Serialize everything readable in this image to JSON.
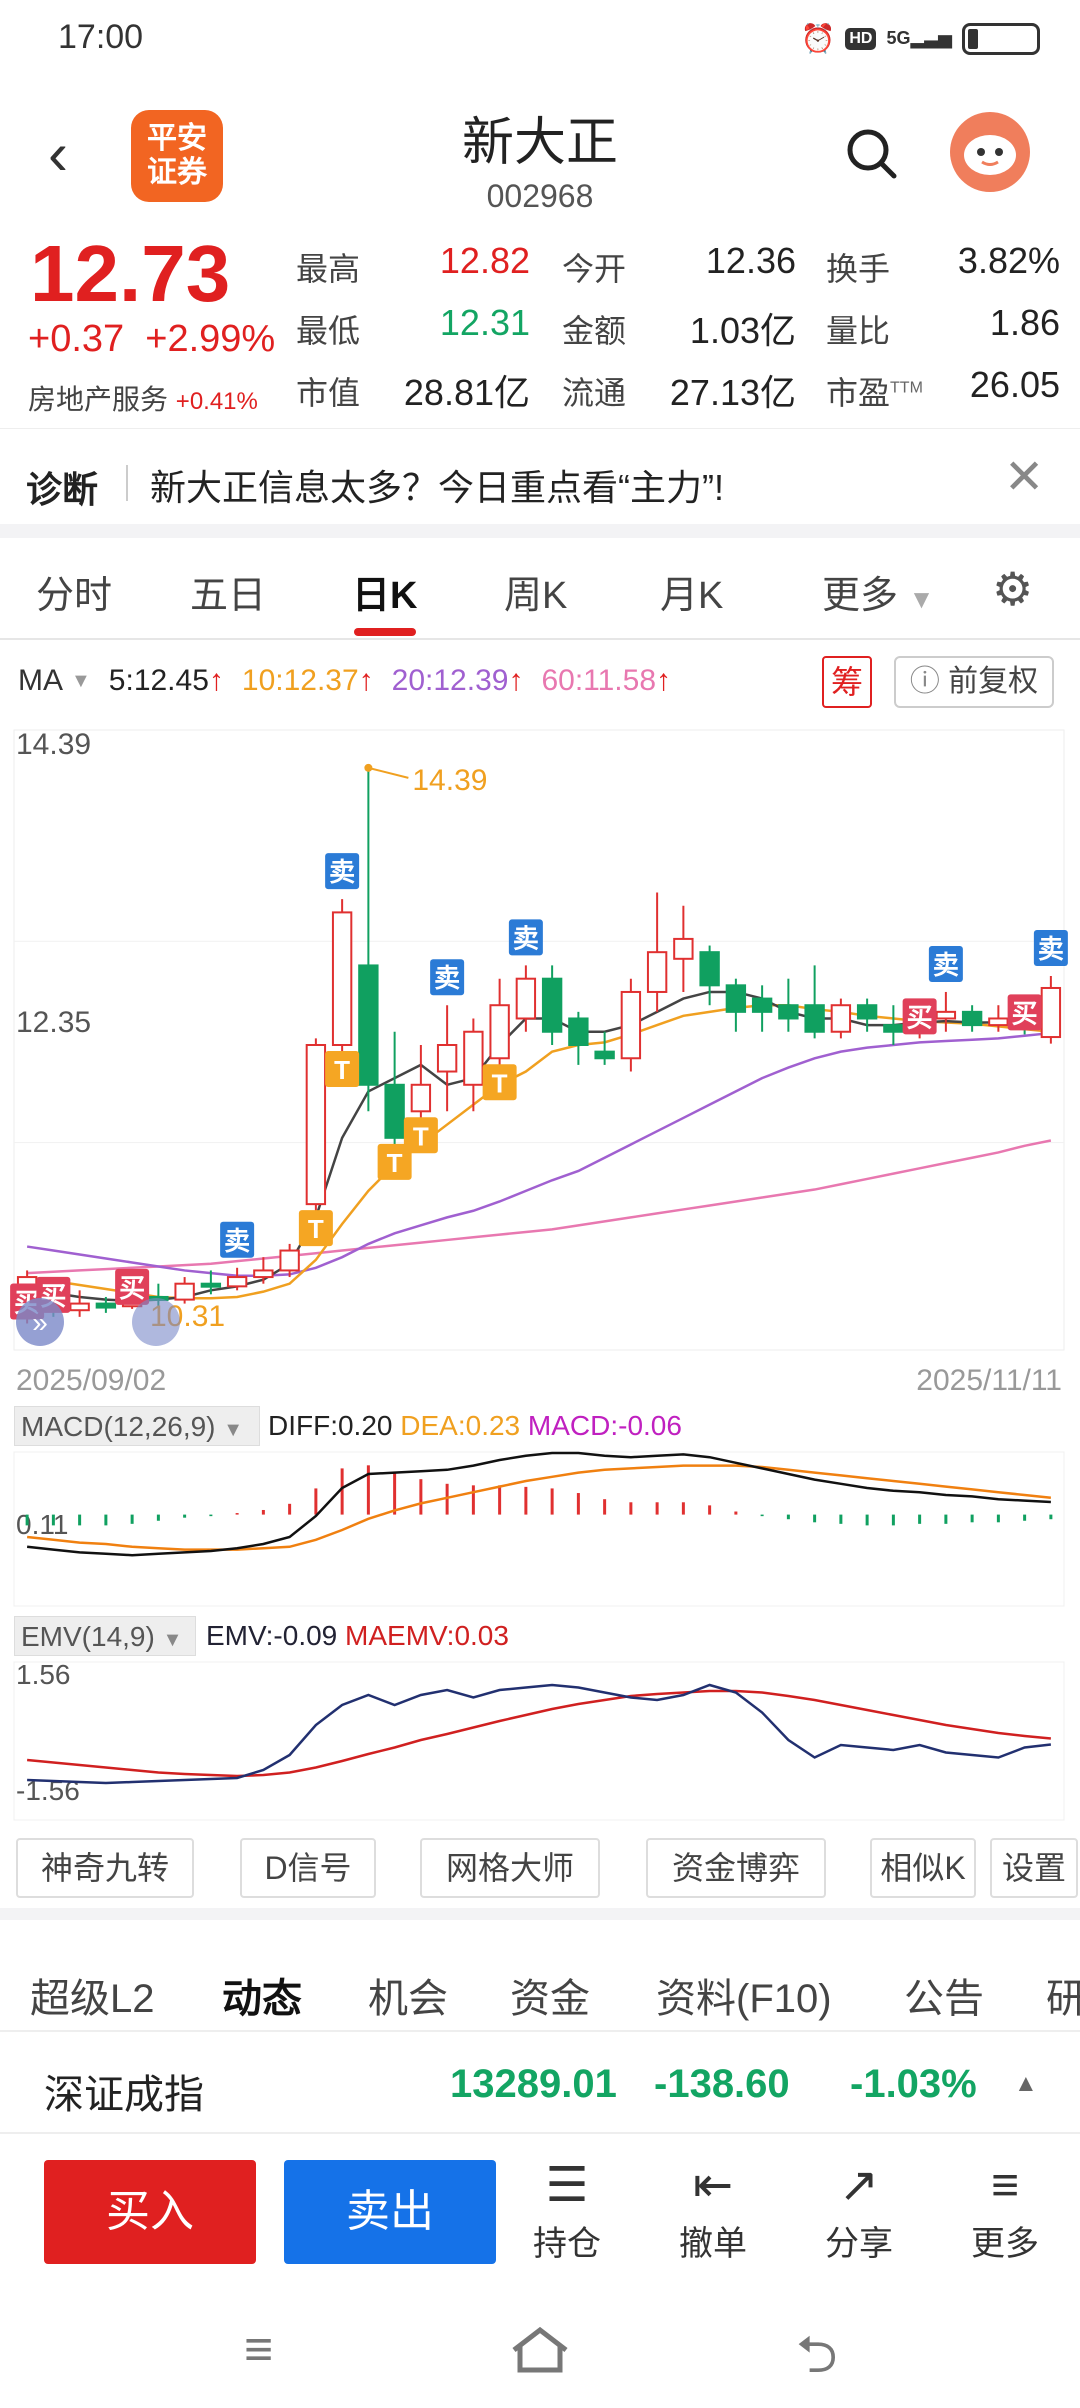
{
  "status": {
    "time": "17:00",
    "net": "5G",
    "hd": "HD"
  },
  "header": {
    "broker_logo": "平安\n证券",
    "name": "新大正",
    "code": "002968"
  },
  "quote": {
    "price": "12.73",
    "change": "+0.37",
    "change_pct": "+2.99%",
    "sector": "房地产服务",
    "sector_pct": "+0.41%",
    "cells": [
      {
        "label": "最高",
        "value": "12.82",
        "color": "red"
      },
      {
        "label": "今开",
        "value": "12.36",
        "color": "normal"
      },
      {
        "label": "换手",
        "value": "3.82%",
        "color": "normal"
      },
      {
        "label": "最低",
        "value": "12.31",
        "color": "green"
      },
      {
        "label": "金额",
        "value": "1.03亿",
        "color": "normal"
      },
      {
        "label": "量比",
        "value": "1.86",
        "color": "normal"
      },
      {
        "label": "市值",
        "value": "28.81亿",
        "color": "normal"
      },
      {
        "label": "流通",
        "value": "27.13亿",
        "color": "normal"
      },
      {
        "label": "市盈",
        "value": "26.05",
        "color": "normal",
        "sup": "TTM"
      }
    ]
  },
  "diagnosis": {
    "tag": "诊断",
    "message": "新大正信息太多？今日重点看“主力”!"
  },
  "chart_tabs": [
    {
      "label": "分时"
    },
    {
      "label": "五日"
    },
    {
      "label": "日K",
      "active": true
    },
    {
      "label": "周K"
    },
    {
      "label": "月K"
    },
    {
      "label": "更多"
    }
  ],
  "ma": {
    "label": "MA",
    "items": [
      {
        "text": "5:12.45",
        "color": "#222"
      },
      {
        "text": "10:12.37",
        "color": "#f0a020"
      },
      {
        "text": "20:12.39",
        "color": "#a060d0"
      },
      {
        "text": "60:11.58",
        "color": "#e878b0"
      }
    ],
    "chou": "筹",
    "fuquan": "前复权"
  },
  "chart_data": {
    "type": "candlestick",
    "y_max_label": "14.39",
    "y_mid_label": "12.35",
    "low_label": "10.31",
    "high_annotation": "14.39",
    "ylim": [
      10.0,
      14.5
    ],
    "start_date": "2025/09/02",
    "end_date": "2025/11/11",
    "candles": [
      [
        10.35,
        10.55,
        10.2,
        10.6
      ],
      [
        10.5,
        10.3,
        10.25,
        10.55
      ],
      [
        10.3,
        10.35,
        10.25,
        10.45
      ],
      [
        10.35,
        10.32,
        10.28,
        10.4
      ],
      [
        10.33,
        10.4,
        10.31,
        10.45
      ],
      [
        10.4,
        10.38,
        10.32,
        10.5
      ],
      [
        10.38,
        10.5,
        10.35,
        10.55
      ],
      [
        10.5,
        10.48,
        10.42,
        10.6
      ],
      [
        10.48,
        10.55,
        10.45,
        10.62
      ],
      [
        10.55,
        10.6,
        10.5,
        10.7
      ],
      [
        10.6,
        10.75,
        10.55,
        10.8
      ],
      [
        11.1,
        12.3,
        11.0,
        12.35
      ],
      [
        12.3,
        13.3,
        12.2,
        13.4
      ],
      [
        12.9,
        12.0,
        11.8,
        14.39
      ],
      [
        12.0,
        11.6,
        11.5,
        12.4
      ],
      [
        11.8,
        12.0,
        11.7,
        12.3
      ],
      [
        12.1,
        12.3,
        11.8,
        12.6
      ],
      [
        12.0,
        12.4,
        11.8,
        12.5
      ],
      [
        12.2,
        12.6,
        12.1,
        12.8
      ],
      [
        12.5,
        12.8,
        12.4,
        12.9
      ],
      [
        12.8,
        12.4,
        12.3,
        12.9
      ],
      [
        12.5,
        12.3,
        12.15,
        12.55
      ],
      [
        12.25,
        12.2,
        12.15,
        12.4
      ],
      [
        12.2,
        12.7,
        12.1,
        12.8
      ],
      [
        12.7,
        13.0,
        12.55,
        13.45
      ],
      [
        12.95,
        13.1,
        12.7,
        13.35
      ],
      [
        13.0,
        12.75,
        12.6,
        13.05
      ],
      [
        12.75,
        12.55,
        12.4,
        12.8
      ],
      [
        12.65,
        12.55,
        12.4,
        12.75
      ],
      [
        12.6,
        12.5,
        12.4,
        12.8
      ],
      [
        12.6,
        12.4,
        12.35,
        12.9
      ],
      [
        12.4,
        12.6,
        12.35,
        12.65
      ],
      [
        12.6,
        12.5,
        12.4,
        12.65
      ],
      [
        12.45,
        12.4,
        12.3,
        12.6
      ],
      [
        12.4,
        12.5,
        12.35,
        12.6
      ],
      [
        12.5,
        12.55,
        12.4,
        12.7
      ],
      [
        12.55,
        12.45,
        12.4,
        12.6
      ],
      [
        12.45,
        12.5,
        12.4,
        12.6
      ],
      [
        12.5,
        12.45,
        12.38,
        12.6
      ],
      [
        12.36,
        12.73,
        12.31,
        12.82
      ]
    ],
    "ma5": [
      10.45,
      10.43,
      10.4,
      10.38,
      10.37,
      10.38,
      10.4,
      10.45,
      10.48,
      10.53,
      10.65,
      11.0,
      11.6,
      11.95,
      12.05,
      12.15,
      12.0,
      12.05,
      12.3,
      12.5,
      12.5,
      12.4,
      12.4,
      12.45,
      12.55,
      12.65,
      12.7,
      12.7,
      12.65,
      12.55,
      12.5,
      12.5,
      12.45,
      12.45,
      12.47,
      12.48,
      12.47,
      12.47,
      12.48,
      12.45
    ],
    "ma10": [
      10.55,
      10.52,
      10.49,
      10.46,
      10.43,
      10.4,
      10.39,
      10.39,
      10.4,
      10.44,
      10.5,
      10.68,
      10.95,
      11.2,
      11.4,
      11.55,
      11.7,
      11.85,
      12.0,
      12.1,
      12.25,
      12.3,
      12.32,
      12.38,
      12.45,
      12.52,
      12.55,
      12.58,
      12.6,
      12.6,
      12.57,
      12.55,
      12.52,
      12.5,
      12.48,
      12.47,
      12.46,
      12.44,
      12.42,
      12.4
    ],
    "ma20": [
      10.78,
      10.75,
      10.72,
      10.69,
      10.66,
      10.63,
      10.6,
      10.58,
      10.56,
      10.56,
      10.57,
      10.62,
      10.7,
      10.8,
      10.88,
      10.94,
      11.0,
      11.05,
      11.12,
      11.2,
      11.28,
      11.35,
      11.45,
      11.55,
      11.65,
      11.75,
      11.85,
      11.95,
      12.05,
      12.13,
      12.2,
      12.25,
      12.28,
      12.3,
      12.32,
      12.33,
      12.34,
      12.35,
      12.37,
      12.39
    ],
    "ma60": [
      10.58,
      10.59,
      10.6,
      10.61,
      10.62,
      10.63,
      10.64,
      10.65,
      10.67,
      10.69,
      10.71,
      10.73,
      10.75,
      10.77,
      10.79,
      10.81,
      10.83,
      10.85,
      10.87,
      10.89,
      10.91,
      10.94,
      10.97,
      11.0,
      11.03,
      11.06,
      11.09,
      11.12,
      11.15,
      11.18,
      11.21,
      11.25,
      11.29,
      11.33,
      11.37,
      11.41,
      11.45,
      11.49,
      11.54,
      11.58
    ],
    "markers": [
      {
        "i": 0,
        "text": "买",
        "type": "buy"
      },
      {
        "i": 1,
        "text": "买",
        "type": "buy"
      },
      {
        "i": 4,
        "text": "买",
        "type": "buy"
      },
      {
        "i": 8,
        "text": "卖",
        "type": "sell"
      },
      {
        "i": 11,
        "text": "T",
        "type": "t"
      },
      {
        "i": 14,
        "text": "T",
        "type": "t"
      },
      {
        "i": 15,
        "text": "T",
        "type": "t"
      },
      {
        "i": 12,
        "text": "T",
        "type": "t"
      },
      {
        "i": 12,
        "text": "卖",
        "type": "sell",
        "high": true
      },
      {
        "i": 16,
        "text": "卖",
        "type": "sell",
        "high": true
      },
      {
        "i": 18,
        "text": "T",
        "type": "t"
      },
      {
        "i": 19,
        "text": "卖",
        "type": "sell",
        "high": true
      },
      {
        "i": 34,
        "text": "买",
        "type": "buy"
      },
      {
        "i": 35,
        "text": "卖",
        "type": "sell"
      },
      {
        "i": 38,
        "text": "买",
        "type": "buy"
      },
      {
        "i": 39,
        "text": "卖",
        "type": "sell",
        "high": true
      }
    ],
    "macd": {
      "label": "MACD(12,26,9)",
      "diff": "DIFF:0.20",
      "dea": "DEA:0.23",
      "macdv": "MACD:-0.06",
      "axis": "0.11",
      "diff_series": [
        -0.12,
        -0.14,
        -0.16,
        -0.17,
        -0.18,
        -0.17,
        -0.16,
        -0.15,
        -0.13,
        -0.1,
        -0.05,
        0.1,
        0.3,
        0.4,
        0.41,
        0.42,
        0.43,
        0.46,
        0.5,
        0.53,
        0.55,
        0.55,
        0.53,
        0.52,
        0.53,
        0.54,
        0.52,
        0.48,
        0.44,
        0.4,
        0.36,
        0.33,
        0.3,
        0.28,
        0.27,
        0.25,
        0.24,
        0.22,
        0.21,
        0.2
      ],
      "dea_series": [
        -0.05,
        -0.07,
        -0.09,
        -0.1,
        -0.12,
        -0.13,
        -0.14,
        -0.14,
        -0.14,
        -0.13,
        -0.12,
        -0.07,
        0.0,
        0.08,
        0.14,
        0.19,
        0.23,
        0.27,
        0.31,
        0.35,
        0.38,
        0.41,
        0.43,
        0.44,
        0.45,
        0.46,
        0.46,
        0.46,
        0.45,
        0.43,
        0.41,
        0.39,
        0.37,
        0.35,
        0.33,
        0.31,
        0.29,
        0.27,
        0.25,
        0.23
      ],
      "hist": [
        -0.14,
        -0.14,
        -0.14,
        -0.14,
        -0.12,
        -0.08,
        -0.04,
        -0.02,
        0.02,
        0.06,
        0.14,
        0.34,
        0.6,
        0.64,
        0.54,
        0.46,
        0.4,
        0.38,
        0.38,
        0.36,
        0.34,
        0.28,
        0.2,
        0.16,
        0.16,
        0.16,
        0.12,
        0.04,
        -0.02,
        -0.06,
        -0.1,
        -0.12,
        -0.14,
        -0.14,
        -0.12,
        -0.12,
        -0.1,
        -0.1,
        -0.08,
        -0.06
      ]
    },
    "emv": {
      "label": "EMV(14,9)",
      "emv_text": "EMV:-0.09",
      "maemv_text": "MAEMV:0.03",
      "top": "1.56",
      "bottom": "-1.56",
      "emv_series": [
        -0.8,
        -0.82,
        -0.84,
        -0.86,
        -0.84,
        -0.82,
        -0.8,
        -0.78,
        -0.76,
        -0.6,
        -0.3,
        0.3,
        0.7,
        0.9,
        0.7,
        0.9,
        1.0,
        0.85,
        1.0,
        1.05,
        1.1,
        1.05,
        0.95,
        0.85,
        0.8,
        0.9,
        1.1,
        0.95,
        0.55,
        0.0,
        -0.35,
        -0.1,
        -0.15,
        -0.2,
        -0.1,
        -0.25,
        -0.3,
        -0.35,
        -0.15,
        -0.09
      ],
      "maemv_series": [
        -0.4,
        -0.45,
        -0.5,
        -0.55,
        -0.6,
        -0.65,
        -0.68,
        -0.7,
        -0.72,
        -0.7,
        -0.65,
        -0.55,
        -0.42,
        -0.28,
        -0.15,
        0.0,
        0.12,
        0.25,
        0.38,
        0.5,
        0.62,
        0.72,
        0.8,
        0.88,
        0.92,
        0.95,
        0.98,
        0.98,
        0.95,
        0.88,
        0.8,
        0.7,
        0.6,
        0.5,
        0.4,
        0.3,
        0.22,
        0.14,
        0.08,
        0.03
      ]
    }
  },
  "tools": [
    {
      "label": "神奇九转"
    },
    {
      "label": "D信号"
    },
    {
      "label": "网格大师"
    },
    {
      "label": "资金博弈"
    },
    {
      "label": "相似K"
    },
    {
      "label": "设置"
    }
  ],
  "detail_tabs": [
    {
      "label": "超级L2"
    },
    {
      "label": "动态",
      "active": true
    },
    {
      "label": "机会"
    },
    {
      "label": "资金"
    },
    {
      "label": "资料(F10)"
    },
    {
      "label": "公告"
    },
    {
      "label": "研"
    }
  ],
  "index": {
    "name": "深证成指",
    "value": "13289.01",
    "change": "-138.60",
    "pct": "-1.03%"
  },
  "actions": {
    "buy": "买入",
    "sell": "卖出",
    "items": [
      {
        "label": "持仓",
        "icon": "☰"
      },
      {
        "label": "撤单",
        "icon": "⇤"
      },
      {
        "label": "分享",
        "icon": "↗"
      },
      {
        "label": "更多",
        "icon": "≡"
      }
    ]
  }
}
